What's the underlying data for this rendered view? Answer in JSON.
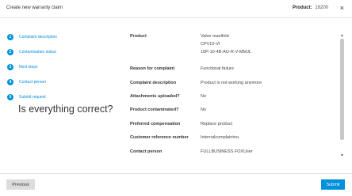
{
  "header": {
    "title": "Create new warranty claim",
    "product_label": "Product:",
    "product_value": "18200",
    "close_glyph": "×"
  },
  "steps": [
    {
      "num": "1",
      "label": "Complaint description"
    },
    {
      "num": "2",
      "label": "Contamination status"
    },
    {
      "num": "3",
      "label": "Next steps"
    },
    {
      "num": "4",
      "label": "Contact person"
    },
    {
      "num": "5",
      "label": "Submit request"
    }
  ],
  "question": "Is everything correct?",
  "summary": {
    "product": {
      "label": "Product",
      "lines": [
        "Valve manifold",
        "CPV10-VI",
        "10P-10-4B-AO-R-V-MMJL"
      ]
    },
    "reason": {
      "label": "Reason for complaint",
      "value": "Functional failure"
    },
    "complaint": {
      "label": "Complaint description",
      "value": "Product is not working anymore"
    },
    "attachments": {
      "label": "Attachments uploaded?",
      "value": "No"
    },
    "contaminated": {
      "label": "Product contaminated?",
      "value": "No"
    },
    "compensation": {
      "label": "Preferred compensation",
      "value": "Replace product"
    },
    "reference": {
      "label": "Customer reference number",
      "value": "Internalcomplaintno."
    },
    "contact": {
      "label": "Contact person",
      "value": "FULLBUSINESS FOXUser"
    }
  },
  "scrollbar": {
    "up_glyph": "▲",
    "down_glyph": "▼"
  },
  "footer": {
    "previous_label": "Previous",
    "submit_label": "Submit"
  },
  "colors": {
    "accent": "#0091dc"
  }
}
